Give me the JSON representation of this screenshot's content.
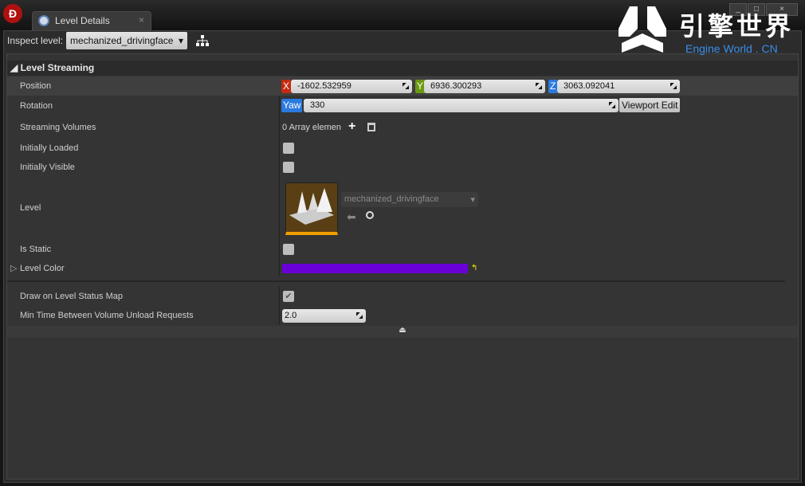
{
  "window": {
    "tab_title": "Level Details",
    "tab_close": "×",
    "minimize": "_",
    "maximize": "□",
    "close": "×"
  },
  "toolbar": {
    "inspect_label": "Inspect level:",
    "inspect_value": "mechanized_drivingface"
  },
  "section": {
    "title": "Level Streaming"
  },
  "properties": {
    "position": {
      "label": "Position",
      "x_axis": "X",
      "x": "-1602.532959",
      "y_axis": "Y",
      "y": "6936.300293",
      "z_axis": "Z",
      "z": "3063.092041"
    },
    "rotation": {
      "label": "Rotation",
      "axis": "Yaw",
      "value": "330",
      "viewport_edit": "Viewport Edit"
    },
    "streaming_volumes": {
      "label": "Streaming Volumes",
      "value": "0 Array elemen"
    },
    "initially_loaded": {
      "label": "Initially Loaded",
      "checked": false
    },
    "initially_visible": {
      "label": "Initially Visible",
      "checked": false
    },
    "level": {
      "label": "Level",
      "asset": "mechanized_drivingface"
    },
    "is_static": {
      "label": "Is Static",
      "checked": false
    },
    "level_color": {
      "label": "Level Color",
      "color": "#6a00d8"
    },
    "draw_on_map": {
      "label": "Draw on Level Status Map",
      "checked": true
    },
    "min_time": {
      "label": "Min Time Between Volume Unload Requests",
      "value": "2.0"
    }
  },
  "watermark": {
    "cn": "引擎世界",
    "en": "Engine World . CN"
  },
  "colors": {
    "x": "#c42a10",
    "y": "#6a9a10",
    "z": "#2a7ae0",
    "yaw": "#2a7ae0",
    "accent": "#f0a000"
  }
}
